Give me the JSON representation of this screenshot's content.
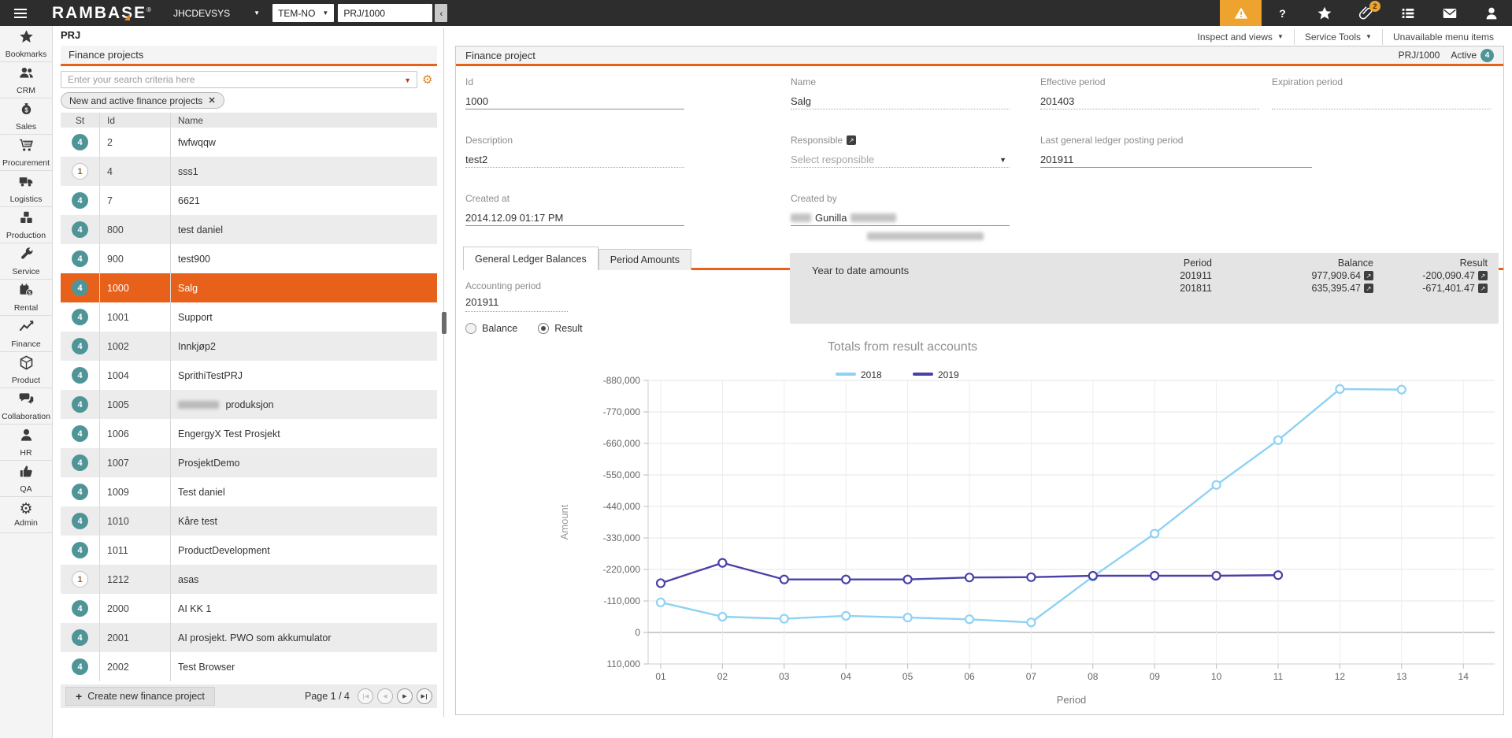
{
  "topbar": {
    "logo": "RAMBASE",
    "logo_reg": "®",
    "environment": "JHCDEVSYS",
    "locale": "TEM-NO",
    "target_value": "PRJ/1000",
    "back_button": "‹",
    "icons": [
      {
        "name": "alert",
        "style": "alert"
      },
      {
        "name": "help"
      },
      {
        "name": "favorites-star"
      },
      {
        "name": "attachments-paperclip",
        "badge": "2"
      },
      {
        "name": "task-list"
      },
      {
        "name": "mail"
      },
      {
        "name": "user"
      }
    ]
  },
  "sidebar": {
    "items": [
      {
        "label": "Bookmarks",
        "icon": "star"
      },
      {
        "label": "CRM",
        "icon": "users"
      },
      {
        "label": "Sales",
        "icon": "moneybag"
      },
      {
        "label": "Procurement",
        "icon": "cart"
      },
      {
        "label": "Logistics",
        "icon": "truck"
      },
      {
        "label": "Production",
        "icon": "cubes"
      },
      {
        "label": "Service",
        "icon": "wrench"
      },
      {
        "label": "Rental",
        "icon": "rental"
      },
      {
        "label": "Finance",
        "icon": "chartline"
      },
      {
        "label": "Product",
        "icon": "cube"
      },
      {
        "label": "Collaboration",
        "icon": "chat"
      },
      {
        "label": "HR",
        "icon": "person"
      },
      {
        "label": "QA",
        "icon": "thumb"
      },
      {
        "label": "Admin",
        "icon": "gear"
      }
    ]
  },
  "page_title": "PRJ",
  "list_panel": {
    "title": "Finance projects",
    "search_placeholder": "Enter your search criteria here",
    "filter_chip": "New and active finance projects",
    "columns": [
      "St",
      "Id",
      "Name"
    ],
    "rows": [
      {
        "st": "4",
        "id": "2",
        "name": "fwfwqqw"
      },
      {
        "st": "1",
        "id": "4",
        "name": "sss1"
      },
      {
        "st": "4",
        "id": "7",
        "name": "6621"
      },
      {
        "st": "4",
        "id": "800",
        "name": "test daniel"
      },
      {
        "st": "4",
        "id": "900",
        "name": "test900"
      },
      {
        "st": "4",
        "id": "1000",
        "name": "Salg",
        "selected": true
      },
      {
        "st": "4",
        "id": "1001",
        "name": "Support"
      },
      {
        "st": "4",
        "id": "1002",
        "name": "Innkjøp2"
      },
      {
        "st": "4",
        "id": "1004",
        "name": "SprithiTestPRJ"
      },
      {
        "st": "4",
        "id": "1005",
        "name": "produksjon",
        "blur_prefix": true
      },
      {
        "st": "4",
        "id": "1006",
        "name": "EngergyX Test Prosjekt"
      },
      {
        "st": "4",
        "id": "1007",
        "name": "ProsjektDemo"
      },
      {
        "st": "4",
        "id": "1009",
        "name": "Test daniel"
      },
      {
        "st": "4",
        "id": "1010",
        "name": "Kåre test"
      },
      {
        "st": "4",
        "id": "1011",
        "name": "ProductDevelopment"
      },
      {
        "st": "1",
        "id": "1212",
        "name": "asas"
      },
      {
        "st": "4",
        "id": "2000",
        "name": "AI KK 1"
      },
      {
        "st": "4",
        "id": "2001",
        "name": "AI prosjekt. PWO som akkumulator"
      },
      {
        "st": "4",
        "id": "2002",
        "name": "Test Browser"
      }
    ],
    "create_button": "Create new finance project",
    "page_info": "Page 1 / 4",
    "nav": [
      {
        "name": "first-page",
        "enabled": false
      },
      {
        "name": "previous-page",
        "enabled": false
      },
      {
        "name": "next-page",
        "enabled": true
      },
      {
        "name": "last-page",
        "enabled": true
      }
    ]
  },
  "menubar": {
    "items": [
      {
        "label": "Inspect and views",
        "dropdown": true
      },
      {
        "label": "Service Tools",
        "dropdown": true
      },
      {
        "label": "Unavailable menu items",
        "dropdown": false
      }
    ]
  },
  "detail_panel": {
    "title": "Finance project",
    "doc_id": "PRJ/1000",
    "status_label": "Active",
    "status_number": "4",
    "fields": [
      {
        "label": "Id",
        "value": "1000",
        "underline": "solid",
        "col": 1,
        "row": 1
      },
      {
        "label": "Name",
        "value": "Salg",
        "underline": "dotted",
        "col": 2,
        "row": 1
      },
      {
        "label": "Effective period",
        "value": "201403",
        "underline": "dotted",
        "col": 3,
        "row": 1
      },
      {
        "label": "Expiration period",
        "value": "",
        "underline": "dotted",
        "col": 4,
        "row": 1
      },
      {
        "label": "Description",
        "value": "test2",
        "underline": "dotted",
        "col": 1,
        "row": 2
      },
      {
        "label": "Responsible",
        "value": "",
        "placeholder": "Select responsible",
        "underline": "dotted",
        "col": 2,
        "row": 2,
        "link_icon": true,
        "dropdown": true
      },
      {
        "label": "Last general ledger posting period",
        "value": "201911",
        "underline": "solid",
        "col": 3,
        "row": 2,
        "wide": true
      },
      {
        "label": "Created at",
        "value": "2014.12.09 01:17 PM",
        "underline": "solid",
        "col": 1,
        "row": 3
      },
      {
        "label": "Created by",
        "value": "Gunilla",
        "underline": "solid",
        "col": 2,
        "row": 3,
        "blurred_prefix": true,
        "blurred_suffix": true
      }
    ],
    "tabs": [
      {
        "label": "General Ledger Balances",
        "active": true
      },
      {
        "label": "Period Amounts",
        "active": false
      }
    ],
    "accounting_period": {
      "label": "Accounting period",
      "value": "201911"
    },
    "radios": [
      {
        "label": "Balance",
        "checked": false
      },
      {
        "label": "Result",
        "checked": true
      }
    ],
    "ytd": {
      "title": "Year to date amounts",
      "columns": [
        "Period",
        "Balance",
        "Result"
      ],
      "rows": [
        {
          "period": "201911",
          "balance": "977,909.64",
          "result": "-200,090.47"
        },
        {
          "period": "201811",
          "balance": "635,395.47",
          "result": "-671,401.47"
        }
      ]
    }
  },
  "chart_data": {
    "type": "line",
    "title": "Totals from result accounts",
    "xlabel": "Period",
    "ylabel": "Amount",
    "categories": [
      "01",
      "02",
      "03",
      "04",
      "05",
      "06",
      "07",
      "08",
      "09",
      "10",
      "11",
      "12",
      "13",
      "14"
    ],
    "y_axis": {
      "min": -880000,
      "max": 110000,
      "step": 110000,
      "inverted": true,
      "tick_labels": [
        "-880,000",
        "-770,000",
        "-660,000",
        "-550,000",
        "-440,000",
        "-330,000",
        "-220,000",
        "-110,000",
        "0",
        "110,000"
      ]
    },
    "grid": true,
    "legend_position": "top",
    "series": [
      {
        "name": "2018",
        "color": "#8ed2f4",
        "values": [
          -105000,
          -55000,
          -48000,
          -58000,
          -52000,
          -46000,
          -35000,
          -195000,
          -345000,
          -515000,
          -671401,
          -850000,
          -848000,
          null
        ]
      },
      {
        "name": "2019",
        "color": "#4a41a8",
        "values": [
          -172000,
          -243000,
          -185000,
          -185000,
          -185000,
          -192000,
          -193000,
          -198000,
          -198000,
          -198000,
          -200090,
          null,
          null,
          null
        ]
      }
    ]
  }
}
